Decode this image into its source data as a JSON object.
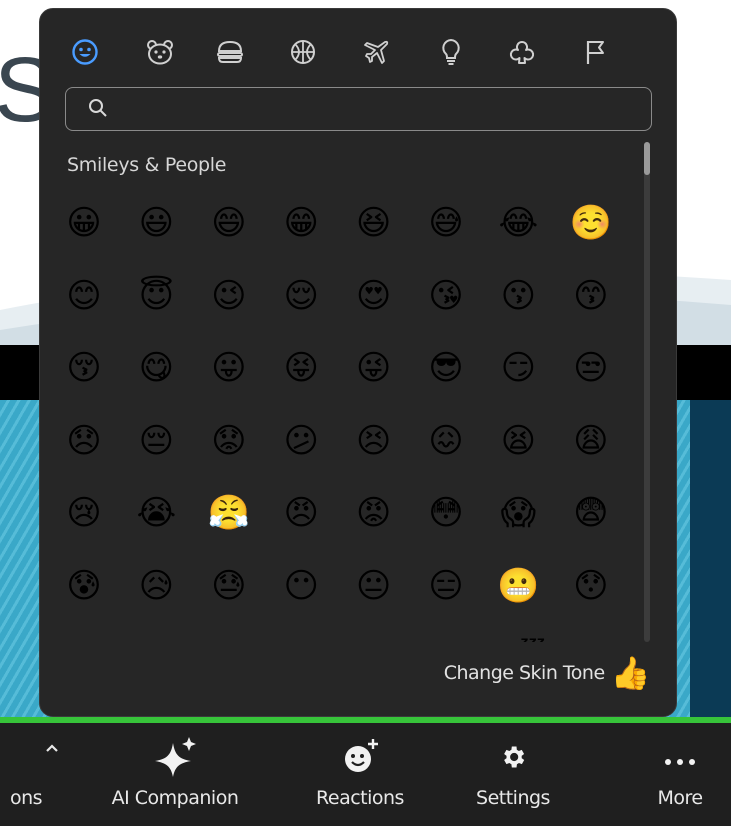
{
  "background": {
    "partial_letter": "S"
  },
  "emoji_picker": {
    "categories": [
      {
        "icon": "smiley-icon",
        "selected": true
      },
      {
        "icon": "animal-icon",
        "selected": false
      },
      {
        "icon": "food-icon",
        "selected": false
      },
      {
        "icon": "activity-icon",
        "selected": false
      },
      {
        "icon": "travel-icon",
        "selected": false
      },
      {
        "icon": "objects-icon",
        "selected": false
      },
      {
        "icon": "symbols-icon",
        "selected": false
      },
      {
        "icon": "flag-icon",
        "selected": false
      }
    ],
    "search": {
      "placeholder": "",
      "value": ""
    },
    "section_title": "Smileys & People",
    "emojis": [
      [
        "😀",
        "😃",
        "😄",
        "😁",
        "😆",
        "😅",
        "😂",
        "☺️"
      ],
      [
        "😊",
        "😇",
        "😉",
        "😌",
        "😍",
        "😘",
        "😗",
        "😙"
      ],
      [
        "😚",
        "😋",
        "😛",
        "😝",
        "😜",
        "😎",
        "😏",
        "😒"
      ],
      [
        "😞",
        "😔",
        "😟",
        "😕",
        "😣",
        "😖",
        "😫",
        "😩"
      ],
      [
        "😢",
        "😭",
        "😤",
        "😠",
        "😡",
        "😳",
        "😱",
        "😨"
      ],
      [
        "😰",
        "😥",
        "😓",
        "😶",
        "😐",
        "😑",
        "😬",
        "😯"
      ],
      [
        "😦",
        "😧",
        "😮",
        "😲",
        "😵",
        "😪",
        "😴",
        "😷"
      ]
    ],
    "change_skin_tone_label": "Change Skin Tone",
    "skin_tone_emoji": "👍"
  },
  "toolbar": {
    "items": [
      {
        "label": "ons",
        "icon": "chevron-up-icon"
      },
      {
        "label": "AI Companion",
        "icon": "ai-sparkle-icon"
      },
      {
        "label": "Reactions",
        "icon": "reactions-icon"
      },
      {
        "label": "Settings",
        "icon": "gear-icon"
      },
      {
        "label": "More",
        "icon": "more-icon"
      }
    ]
  },
  "colors": {
    "accent": "#4a9cff",
    "panel": "#262626",
    "toolbar": "#1f1f1f",
    "green": "#37c43a"
  }
}
